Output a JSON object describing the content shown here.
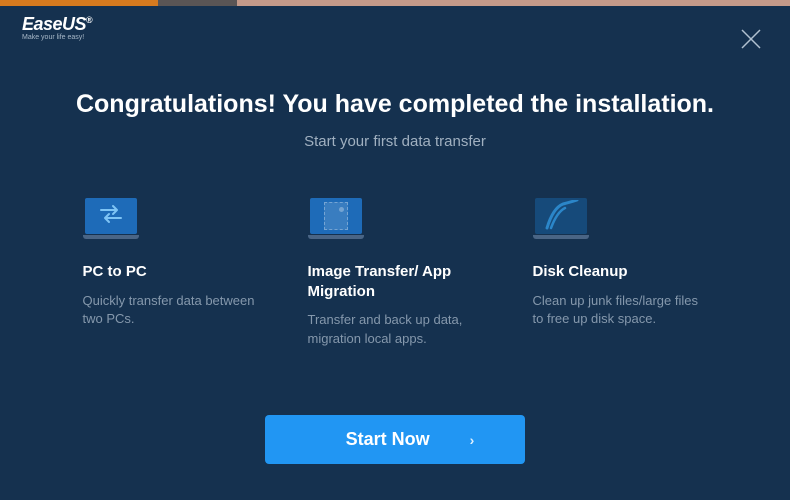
{
  "brand": {
    "name": "EaseUS",
    "tagline": "Make your life easy!"
  },
  "main": {
    "title": "Congratulations! You have completed the installation.",
    "subtitle": "Start your first data transfer"
  },
  "features": [
    {
      "title": "PC to PC",
      "description": "Quickly transfer data between two PCs."
    },
    {
      "title": "Image Transfer/ App Migration",
      "description": "Transfer and back up data, migration local apps."
    },
    {
      "title": "Disk Cleanup",
      "description": "Clean up junk files/large files to free up disk space."
    }
  ],
  "cta": {
    "label": "Start Now"
  }
}
